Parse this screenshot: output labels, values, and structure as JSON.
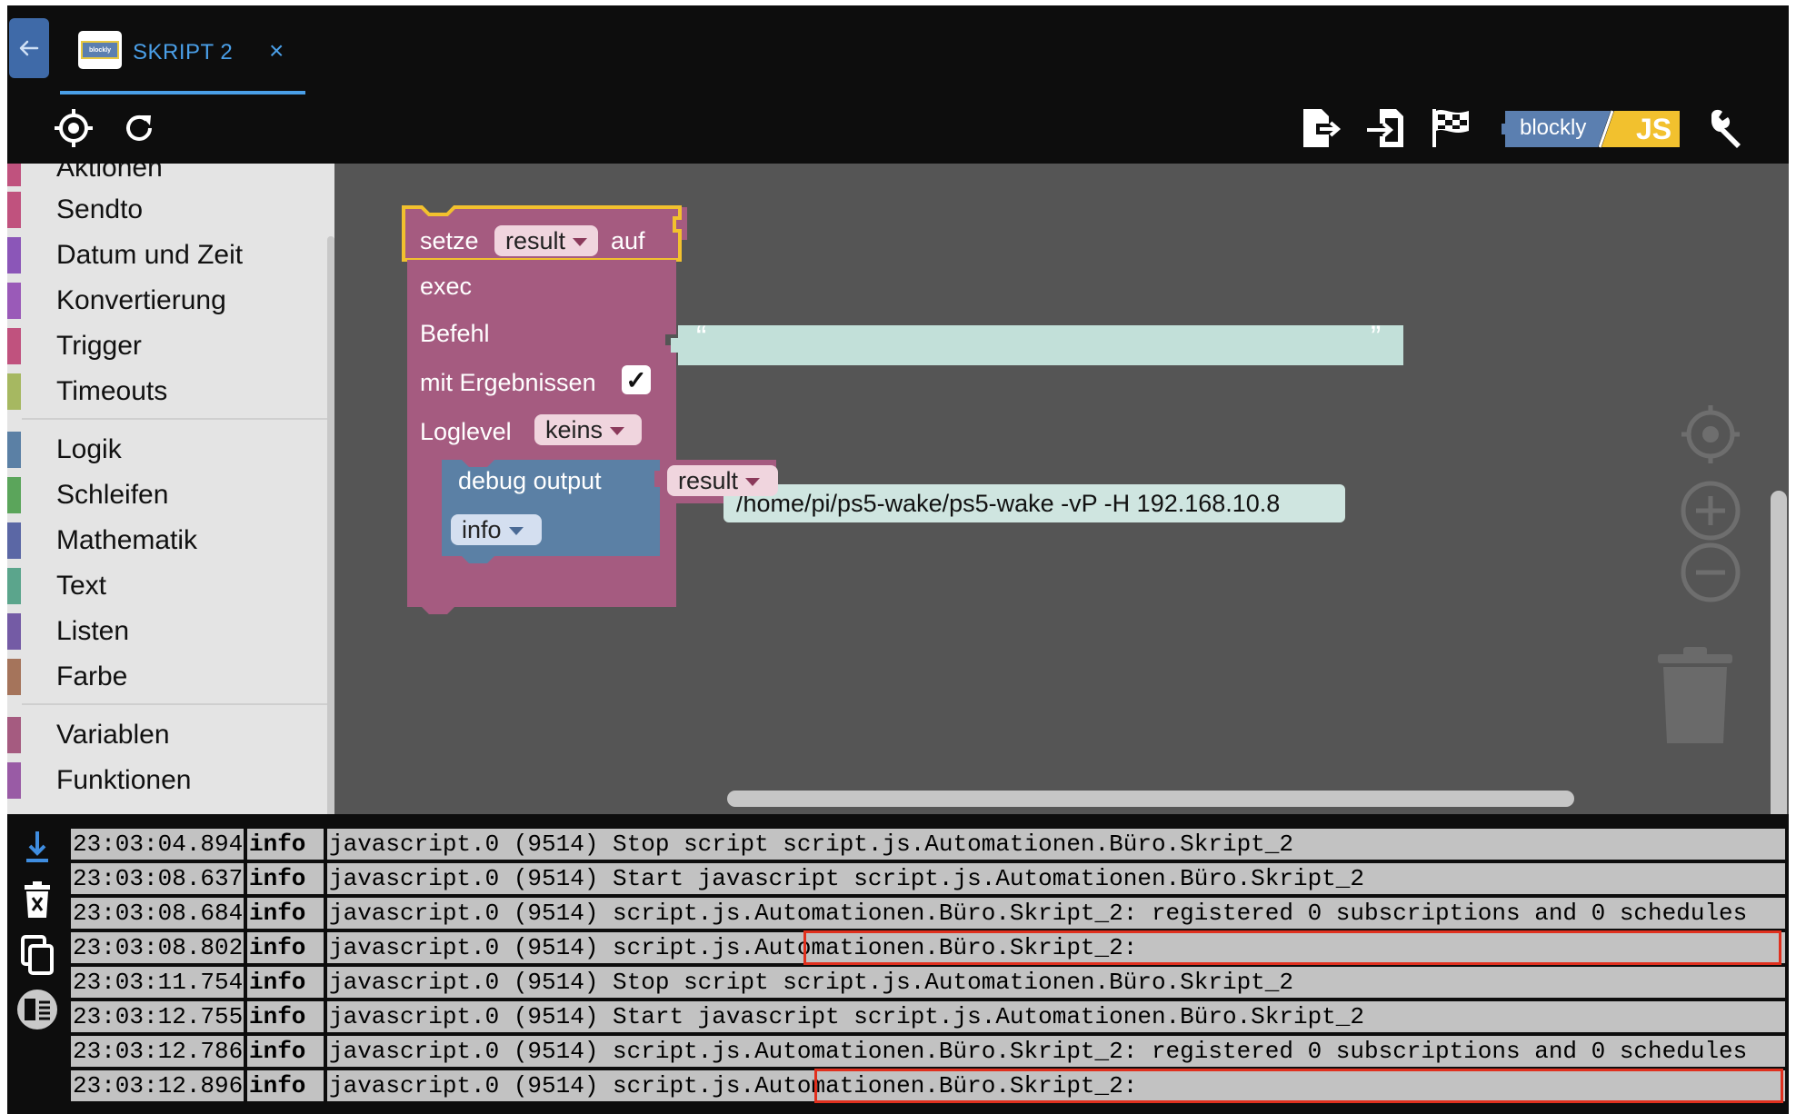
{
  "tab": {
    "title": "SKRIPT 2",
    "logo_text": "blockly",
    "close_symbol": "×"
  },
  "toolbar": {
    "left_icons": [
      "target-icon",
      "refresh-icon"
    ],
    "right_icons": [
      "export-icon",
      "import-icon",
      "flag-icon",
      "blockly-js-logo",
      "wrench-icon"
    ],
    "logo_blockly": "blockly",
    "logo_js": "JS"
  },
  "toolbox": {
    "partial_top": "Aktionen",
    "groups": [
      [
        {
          "label": "Sendto",
          "color": "#c0527e"
        },
        {
          "label": "Datum und Zeit",
          "color": "#8b56b8"
        },
        {
          "label": "Konvertierung",
          "color": "#9a5ab8"
        },
        {
          "label": "Trigger",
          "color": "#c0527e"
        },
        {
          "label": "Timeouts",
          "color": "#a6b861"
        }
      ],
      [
        {
          "label": "Logik",
          "color": "#5b80a5"
        },
        {
          "label": "Schleifen",
          "color": "#5ba55b"
        },
        {
          "label": "Mathematik",
          "color": "#5b67a5"
        },
        {
          "label": "Text",
          "color": "#5ba58c"
        },
        {
          "label": "Listen",
          "color": "#745ba5"
        },
        {
          "label": "Farbe",
          "color": "#a5745b"
        }
      ],
      [
        {
          "label": "Variablen",
          "color": "#a55b80"
        },
        {
          "label": "Funktionen",
          "color": "#995ba5"
        }
      ]
    ]
  },
  "workspace": {
    "set_block": {
      "keyword": "setze",
      "variable": "result",
      "suffix": "auf"
    },
    "exec_block": {
      "title": "exec",
      "command_label": "Befehl",
      "command": "/home/pi/ps5-wake/ps5-wake -vP -H 192.168.10.8",
      "quote_open": "“",
      "quote_close": "”",
      "results_label": "mit Ergebnissen",
      "results_checked": "✓",
      "loglevel_label": "Loglevel",
      "loglevel": "keins"
    },
    "debug_block": {
      "label": "debug output",
      "variable": "result",
      "level": "info"
    }
  },
  "log": {
    "rows": [
      {
        "time": "23:03:04.894",
        "severity": "info",
        "message": "javascript.0 (9514) Stop script script.js.Automationen.Büro.Skript_2"
      },
      {
        "time": "23:03:08.637",
        "severity": "info",
        "message": "javascript.0 (9514) Start javascript script.js.Automationen.Büro.Skript_2"
      },
      {
        "time": "23:03:08.684",
        "severity": "info",
        "message": "javascript.0 (9514) script.js.Automationen.Büro.Skript_2: registered 0 subscriptions and 0 schedules"
      },
      {
        "time": "23:03:08.802",
        "severity": "info",
        "message": "javascript.0 (9514) script.js.Automationen.Büro.Skript_2:"
      },
      {
        "time": "23:03:11.754",
        "severity": "info",
        "message": "javascript.0 (9514) Stop script script.js.Automationen.Büro.Skript_2"
      },
      {
        "time": "23:03:12.755",
        "severity": "info",
        "message": "javascript.0 (9514) Start javascript script.js.Automationen.Büro.Skript_2"
      },
      {
        "time": "23:03:12.786",
        "severity": "info",
        "message": "javascript.0 (9514) script.js.Automationen.Büro.Skript_2: registered 0 subscriptions and 0 schedules"
      },
      {
        "time": "23:03:12.896",
        "severity": "info",
        "message": "javascript.0 (9514) script.js.Automationen.Büro.Skript_2:"
      }
    ],
    "highlight_color": "#e0301e"
  }
}
